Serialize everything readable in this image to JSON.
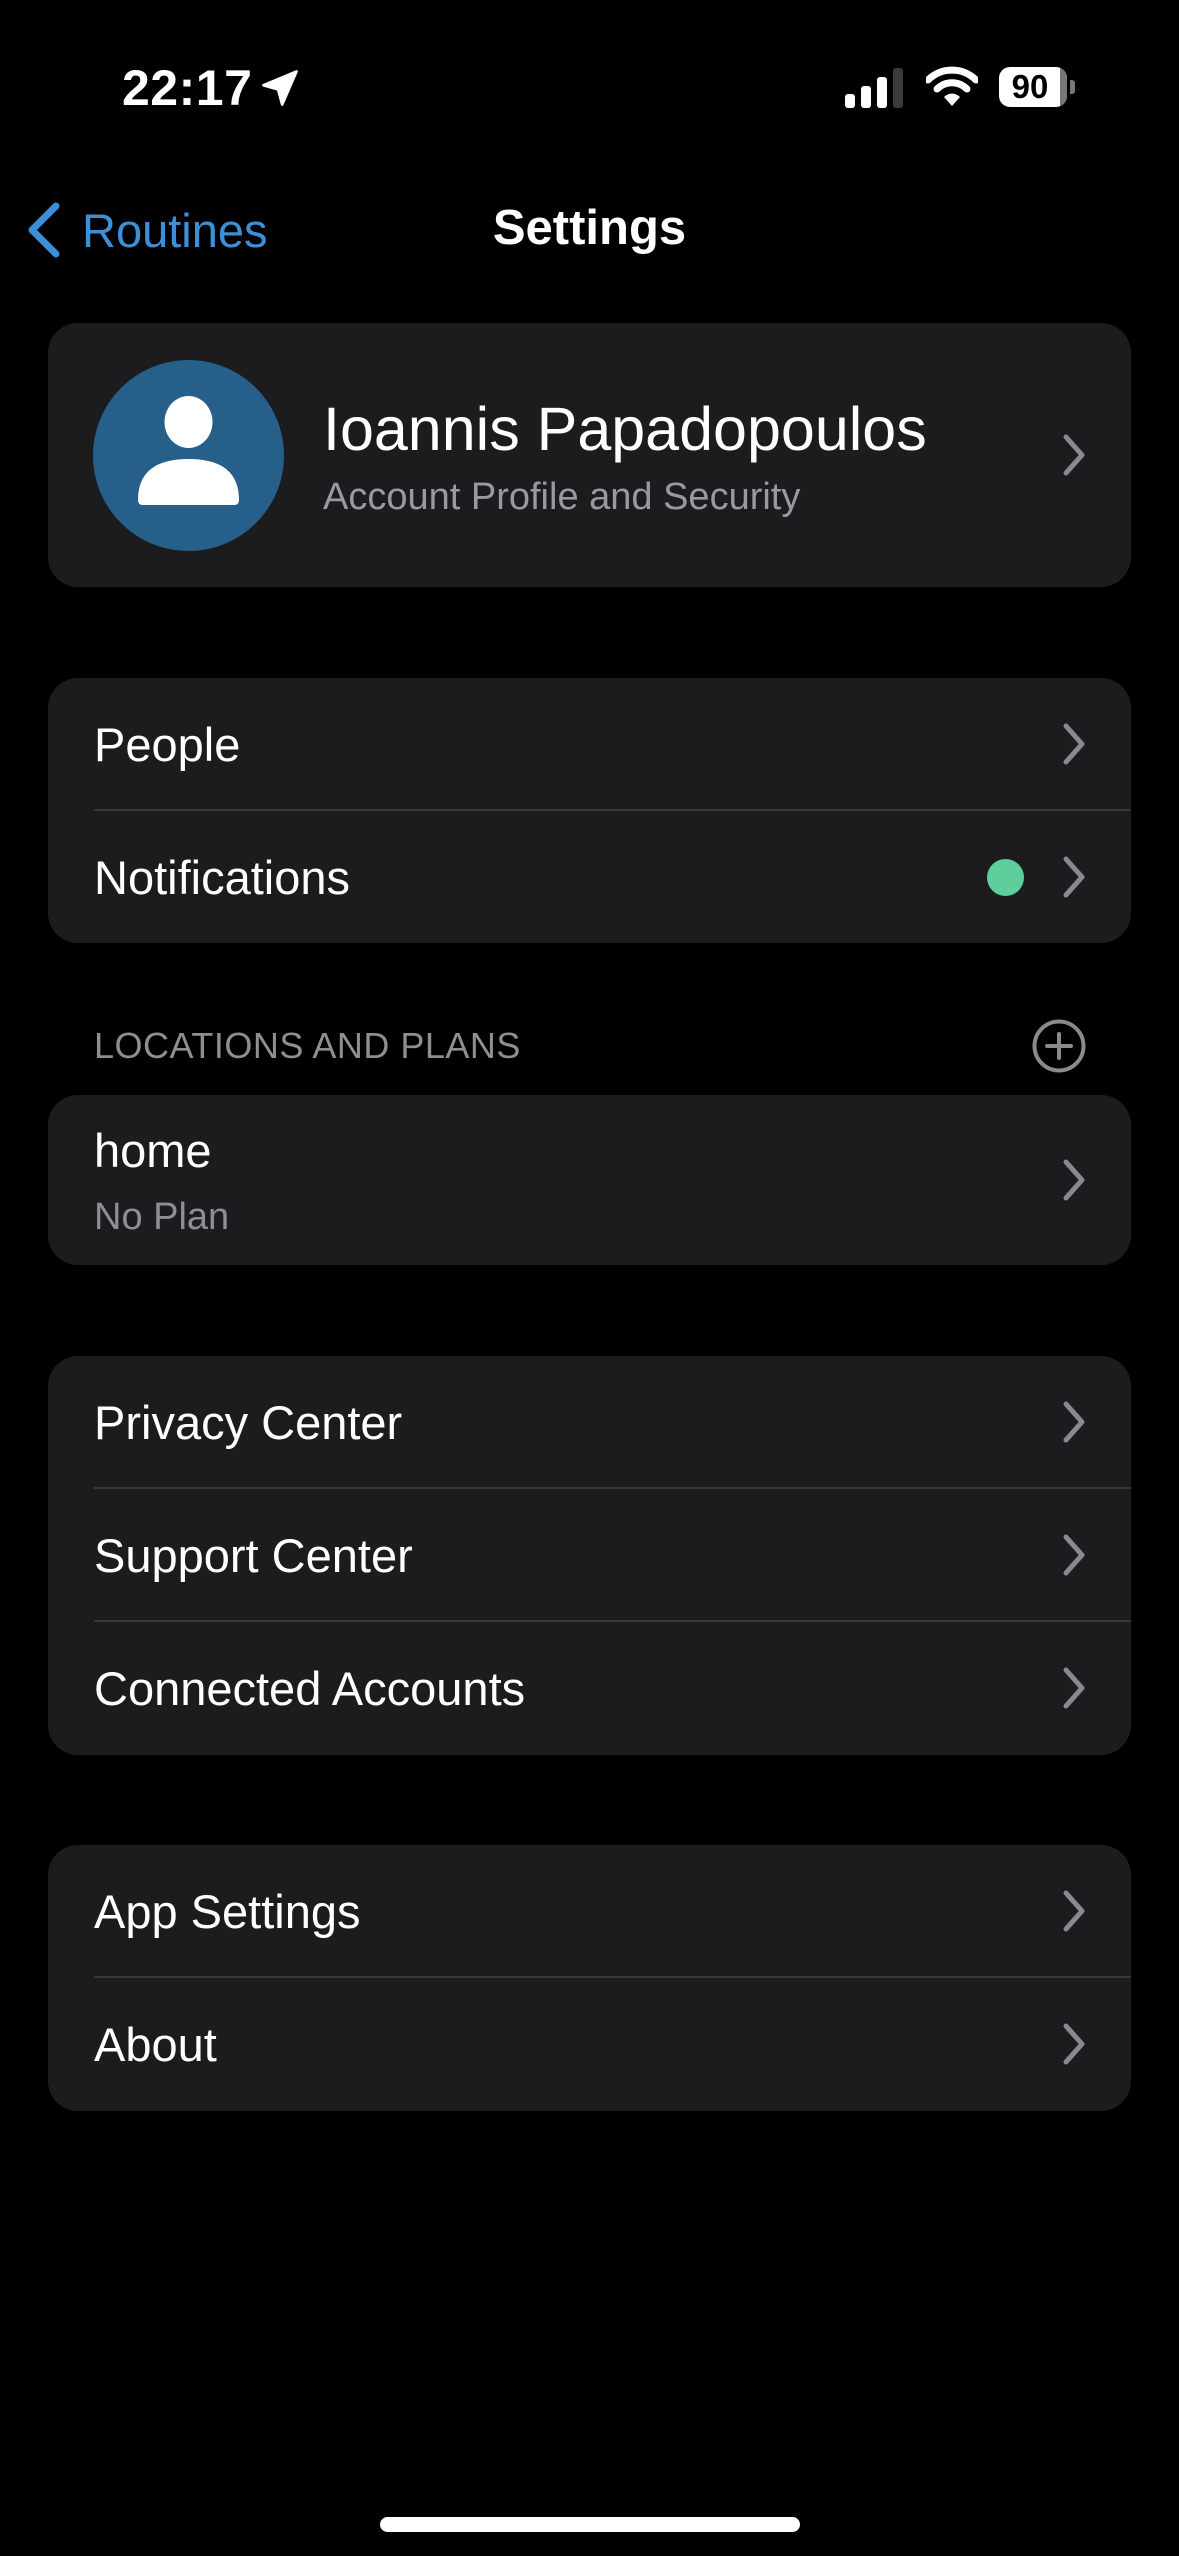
{
  "status_bar": {
    "time": "22:17",
    "location_icon": "location-arrow-icon",
    "signal_bars_active": 3,
    "signal_bars_total": 4,
    "wifi_icon": "wifi-icon",
    "battery_percent": "90"
  },
  "nav": {
    "back_label": "Routines",
    "title": "Settings"
  },
  "profile": {
    "name": "Ioannis Papadopoulos",
    "subtitle": "Account Profile and Security",
    "avatar_icon": "person-icon",
    "avatar_color": "#265f8a"
  },
  "group1": {
    "items": [
      {
        "label": "People"
      },
      {
        "label": "Notifications",
        "badge": "green-dot",
        "badge_color": "#5ccf9c"
      }
    ]
  },
  "locations": {
    "header": "LOCATIONS AND PLANS",
    "add_icon": "plus-circle-icon",
    "items": [
      {
        "title": "home",
        "subtitle": "No Plan"
      }
    ]
  },
  "group2": {
    "items": [
      {
        "label": "Privacy Center"
      },
      {
        "label": "Support Center"
      },
      {
        "label": "Connected Accounts"
      }
    ]
  },
  "group3": {
    "items": [
      {
        "label": "App Settings"
      },
      {
        "label": "About"
      }
    ]
  },
  "colors": {
    "accent": "#3d8fd6",
    "card_bg": "#1c1c1e",
    "secondary_text": "#8e8e93",
    "chevron": "#8a8a8e"
  }
}
